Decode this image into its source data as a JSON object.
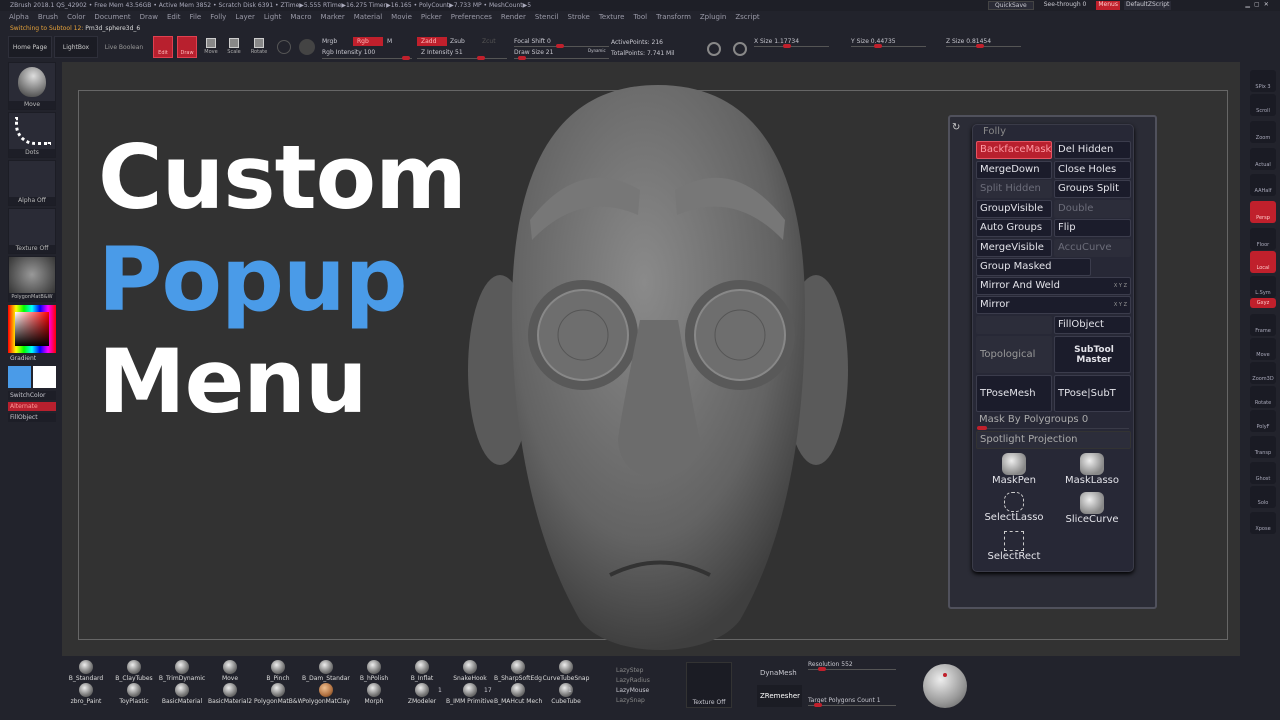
{
  "titlebar": {
    "text": "ZBrush 2018.1   QS_42902   • Free Mem 43.56GB • Active Mem 3852 • Scratch Disk 6391 •  ZTime▶5.555 RTime▶16.275 Timer▶16.165 • PolyCount▶7.733 MP  • MeshCount▶5"
  },
  "menus": [
    "Alpha",
    "Brush",
    "Color",
    "Document",
    "Draw",
    "Edit",
    "File",
    "Folly",
    "Layer",
    "Light",
    "Macro",
    "Marker",
    "Material",
    "Movie",
    "Picker",
    "Preferences",
    "Render",
    "Stencil",
    "Stroke",
    "Texture",
    "Tool",
    "Transform",
    "Zplugin",
    "Zscript"
  ],
  "topright": {
    "quicksave": "QuickSave",
    "seethrough": "See-through  0",
    "menus": "Menus",
    "script": "DefaultZScript"
  },
  "status": {
    "prefix": "Switching to Subtool 12:",
    "name": "Pm3d_sphere3d_6"
  },
  "toolbar": {
    "home": "Home Page",
    "lightbox": "LightBox",
    "liveboolean": "Live Boolean",
    "edit": "Edit",
    "draw": "Draw",
    "move": "Move",
    "scale": "Scale",
    "rotate": "Rotate",
    "mrgb": "Mrgb",
    "rgb": "Rgb",
    "m": "M",
    "rgb_intensity": "Rgb Intensity 100",
    "zadd": "Zadd",
    "zsub": "Zsub",
    "zcut": "Zcut",
    "z_intensity": "Z Intensity 51",
    "focal_shift": "Focal Shift 0",
    "draw_size": "Draw Size 21",
    "dynamic": "Dynamic",
    "active_points": "ActivePoints: 216",
    "total_points": "TotalPoints: 7.741 Mil",
    "xsize": "X Size 1.17734",
    "ysize": "Y Size 0.44735",
    "zsize": "Z Size 0.81454"
  },
  "leftshelf": {
    "brush": "Move",
    "stroke": "Dots",
    "alpha": "Alpha Off",
    "texture": "Texture Off",
    "material": "PolygonMatB&W",
    "gradient": "Gradient",
    "switchcolor": "SwitchColor",
    "alternate": "Alternate",
    "fillobject": "FillObject",
    "main_color": "#4a9be8",
    "secondary_color": "#ffffff"
  },
  "overlay": {
    "line1": "Custom",
    "line2": "Popup",
    "line3": "Menu",
    "accent": "#4a9be8"
  },
  "popup": {
    "title": "Folly",
    "buttons": [
      {
        "label": "BackfaceMask",
        "state": "active"
      },
      {
        "label": "Del Hidden",
        "state": "normal"
      },
      {
        "label": "MergeDown",
        "state": "normal"
      },
      {
        "label": "Close Holes",
        "state": "normal"
      },
      {
        "label": "Split Hidden",
        "state": "disabled"
      },
      {
        "label": "Groups Split",
        "state": "normal"
      },
      {
        "label": "GroupVisible",
        "state": "normal"
      },
      {
        "label": "Double",
        "state": "disabled"
      },
      {
        "label": "Auto Groups",
        "state": "normal"
      },
      {
        "label": "Flip",
        "state": "normal"
      },
      {
        "label": "MergeVisible",
        "state": "normal"
      },
      {
        "label": "AccuCurve",
        "state": "disabled"
      }
    ],
    "group_masked": "Group Masked",
    "mirror_weld": "Mirror And Weld",
    "mirror": "Mirror",
    "xyz": "X Y Z",
    "fillobject": "FillObject",
    "topological": "Topological",
    "subtool_master": "SubTool Master",
    "tposemesh": "TPoseMesh",
    "tpose_subt": "TPose|SubT",
    "mask_by_polygroups": "Mask By Polygroups 0",
    "mask_by_polygroups_value": 0,
    "spotlight": "Spotlight Projection",
    "tools": [
      "MaskPen",
      "MaskLasso",
      "SelectLasso",
      "SliceCurve",
      "SelectRect"
    ]
  },
  "rightshelf": [
    "SPix 3",
    "Scroll",
    "Zoom",
    "Actual",
    "AAHalf",
    "Persp",
    "Floor",
    "Local",
    "L.Sym",
    "Gxyz",
    "Frame",
    "Move",
    "Zoom3D",
    "Rotate",
    "PolyF",
    "Transp",
    "Ghost",
    "Solo",
    "Xpose"
  ],
  "bottom": {
    "row1": [
      "B_Standard",
      "B_ClayTubes",
      "B_TrimDynamic",
      "Move",
      "B_Pinch",
      "B_Dam_Standard",
      "B_hPolish",
      "B_Inflat",
      "SnakeHook",
      "B_SharpSoftEdge",
      "CurveTubeSnap"
    ],
    "row2": [
      "zbro_Paint",
      "ToyPlastic",
      "BasicMaterial",
      "BasicMaterial2",
      "PolygonMatB&W",
      "PolygonMatClay",
      "Morph",
      "ZModeler",
      "B_IMM Primitives",
      "B_MAHcut Mech",
      "CubeTube"
    ],
    "counts": [
      "1",
      "17",
      "1"
    ],
    "lazy": [
      "LazyStep",
      "LazyRadius",
      "LazyMouse",
      "LazySnap"
    ],
    "texture": "Texture Off",
    "dynamesh": "DynaMesh",
    "zremesher": "ZRemesher",
    "resolution": "Resolution 552",
    "target": "Target Polygons Count 1"
  }
}
